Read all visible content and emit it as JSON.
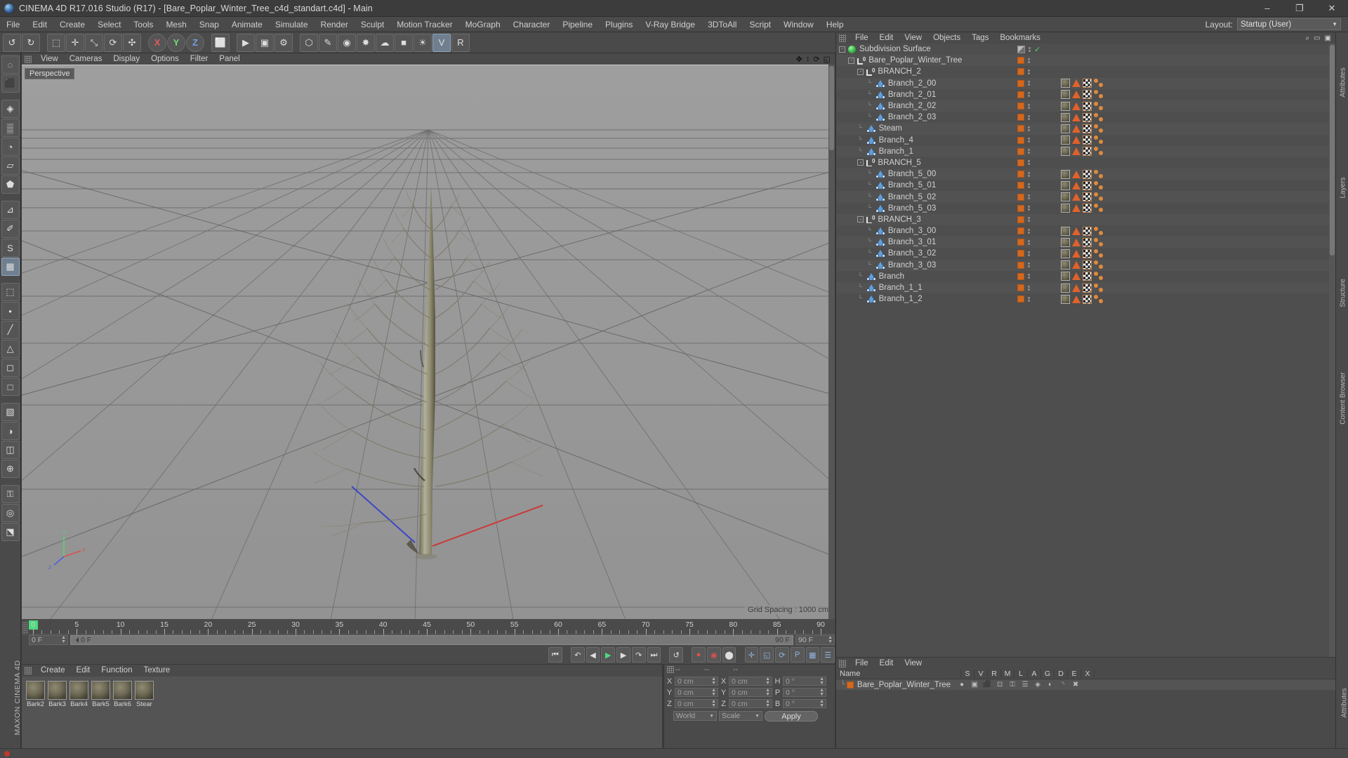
{
  "window": {
    "title": "CINEMA 4D R17.016 Studio (R17) - [Bare_Poplar_Winter_Tree_c4d_standart.c4d] - Main",
    "minimize": "–",
    "maximize": "❐",
    "close": "✕",
    "app_icon": "cinema4d-logo-icon"
  },
  "menubar": {
    "items": [
      "File",
      "Edit",
      "Create",
      "Select",
      "Tools",
      "Mesh",
      "Snap",
      "Animate",
      "Simulate",
      "Render",
      "Sculpt",
      "Motion Tracker",
      "MoGraph",
      "Character",
      "Pipeline",
      "Plugins",
      "V-Ray Bridge",
      "3DToAll",
      "Script",
      "Window",
      "Help"
    ],
    "layout_label": "Layout:",
    "layout_value": "Startup (User)"
  },
  "toolbar": {
    "buttons": [
      {
        "name": "undo-button",
        "glyph": "↺"
      },
      {
        "name": "redo-button",
        "glyph": "↻"
      },
      {
        "name": "live-selection-tool",
        "glyph": "⬚"
      },
      {
        "name": "move-tool",
        "glyph": "✛"
      },
      {
        "name": "scale-tool",
        "glyph": "⤡"
      },
      {
        "name": "rotate-tool",
        "glyph": "⟳"
      },
      {
        "name": "auto-tool",
        "glyph": "✣"
      },
      {
        "name": "axis-x-lock",
        "glyph": "X"
      },
      {
        "name": "axis-y-lock",
        "glyph": "Y"
      },
      {
        "name": "axis-z-lock",
        "glyph": "Z"
      },
      {
        "name": "world-object-coords",
        "glyph": "⬜"
      },
      {
        "name": "render-view-button",
        "glyph": "▶"
      },
      {
        "name": "render-region-button",
        "glyph": "▣"
      },
      {
        "name": "render-settings-button",
        "glyph": "⚙"
      },
      {
        "name": "cube-primitive-button",
        "glyph": "⬡"
      },
      {
        "name": "spline-pen-button",
        "glyph": "✎"
      },
      {
        "name": "generator-button",
        "glyph": "◉"
      },
      {
        "name": "deformer-button",
        "glyph": "✸"
      },
      {
        "name": "environment-button",
        "glyph": "☁"
      },
      {
        "name": "camera-button",
        "glyph": "■"
      },
      {
        "name": "light-button",
        "glyph": "☀"
      },
      {
        "name": "vray-button",
        "glyph": "V"
      },
      {
        "name": "vray-render-button",
        "glyph": "R"
      }
    ]
  },
  "left_tools": {
    "buttons": [
      {
        "name": "live-selection-icon",
        "glyph": "◌"
      },
      {
        "name": "box-primitive-icon",
        "glyph": "⬛"
      },
      {
        "name": "magnet-icon",
        "glyph": "◈"
      },
      {
        "name": "knife-icon",
        "glyph": "▒"
      },
      {
        "name": "brush-icon",
        "glyph": "◔"
      },
      {
        "name": "polygon-pen-icon",
        "glyph": "▱"
      },
      {
        "name": "extrude-icon",
        "glyph": "⬟"
      },
      {
        "name": "measure-icon",
        "glyph": "⊿"
      },
      {
        "name": "paint-icon",
        "glyph": "✐"
      },
      {
        "name": "sculpt-icon",
        "glyph": "S"
      },
      {
        "name": "uv-icon",
        "glyph": "▦"
      },
      {
        "name": "axis-icon",
        "glyph": "⬚"
      },
      {
        "name": "point-mode-icon",
        "glyph": "•"
      },
      {
        "name": "edge-mode-icon",
        "glyph": "╱"
      },
      {
        "name": "polygon-mode-icon",
        "glyph": "△"
      },
      {
        "name": "model-mode-icon",
        "glyph": "◻"
      },
      {
        "name": "object-mode-icon",
        "glyph": "□"
      },
      {
        "name": "texture-mode-icon",
        "glyph": "▧"
      },
      {
        "name": "animation-mode-icon",
        "glyph": "◑"
      },
      {
        "name": "workplane-icon",
        "glyph": "◫"
      },
      {
        "name": "enable-axis-icon",
        "glyph": "⊕"
      },
      {
        "name": "lock-icon",
        "glyph": "⚿"
      },
      {
        "name": "viewport-solo-icon",
        "glyph": "◎"
      },
      {
        "name": "snap-icon",
        "glyph": "⬔"
      }
    ]
  },
  "brand_text": "MAXON CINEMA 4D",
  "viewport": {
    "menu": [
      "View",
      "Cameras",
      "Display",
      "Options",
      "Filter",
      "Panel"
    ],
    "label": "Perspective",
    "grid_spacing": "Grid Spacing : 1000 cm",
    "corner_icons": [
      {
        "name": "pan-viewport-icon",
        "glyph": "✥"
      },
      {
        "name": "zoom-viewport-icon",
        "glyph": "↕"
      },
      {
        "name": "rotate-viewport-icon",
        "glyph": "⟳"
      },
      {
        "name": "maximize-viewport-icon",
        "glyph": "◱"
      }
    ]
  },
  "timeline": {
    "ticks": [
      0,
      5,
      10,
      15,
      20,
      25,
      30,
      35,
      40,
      45,
      50,
      55,
      60,
      65,
      70,
      75,
      80,
      85,
      90
    ],
    "current_frame": "0 F",
    "current_frame_field": "0 F",
    "end_frame_field": "90 F",
    "max_frame_field": "90 F",
    "preview_end": "90 F"
  },
  "playback": {
    "buttons": [
      {
        "name": "go-to-start-button",
        "glyph": "⏮"
      },
      {
        "name": "previous-keyframe-button",
        "glyph": "↶"
      },
      {
        "name": "step-back-button",
        "glyph": "◀"
      },
      {
        "name": "play-button",
        "glyph": "▶"
      },
      {
        "name": "step-forward-button",
        "glyph": "▶"
      },
      {
        "name": "next-keyframe-button",
        "glyph": "↷"
      },
      {
        "name": "go-to-end-button",
        "glyph": "⏭"
      },
      {
        "name": "loop-button",
        "glyph": "↺"
      },
      {
        "name": "record-active-objects-button",
        "glyph": "●"
      },
      {
        "name": "autokeying-button",
        "glyph": "◉"
      },
      {
        "name": "keyframe-selection-button",
        "glyph": "⬤"
      },
      {
        "name": "position-key-button",
        "glyph": "✛"
      },
      {
        "name": "scale-key-button",
        "glyph": "◱"
      },
      {
        "name": "rotation-key-button",
        "glyph": "⟳"
      },
      {
        "name": "parameter-key-button",
        "glyph": "P"
      },
      {
        "name": "pla-key-button",
        "glyph": "▦"
      },
      {
        "name": "timeline-settings-button",
        "glyph": "☰"
      }
    ]
  },
  "material_manager": {
    "menu": [
      "Create",
      "Edit",
      "Function",
      "Texture"
    ],
    "materials": [
      {
        "name": "Bark2"
      },
      {
        "name": "Bark3"
      },
      {
        "name": "Bark4"
      },
      {
        "name": "Bark5"
      },
      {
        "name": "Bark6"
      },
      {
        "name": "Stear"
      }
    ]
  },
  "coordinates": {
    "header": [
      "--",
      "--",
      "--"
    ],
    "rows": [
      {
        "pos_label": "X",
        "pos_value": "0 cm",
        "size_label": "X",
        "size_value": "0 cm",
        "rot_label": "H",
        "rot_value": "0 °"
      },
      {
        "pos_label": "Y",
        "pos_value": "0 cm",
        "size_label": "Y",
        "size_value": "0 cm",
        "rot_label": "P",
        "rot_value": "0 °"
      },
      {
        "pos_label": "Z",
        "pos_value": "0 cm",
        "size_label": "Z",
        "size_value": "0 cm",
        "rot_label": "B",
        "rot_value": "0 °"
      }
    ],
    "world_select": "World",
    "scale_select": "Scale",
    "apply_button": "Apply"
  },
  "object_manager": {
    "menu": [
      "File",
      "Edit",
      "View",
      "Objects",
      "Tags",
      "Bookmarks"
    ],
    "rows": [
      {
        "label": "Subdivision Surface",
        "depth": 0,
        "icon": "subdivision-surface-icon",
        "expander": "-",
        "tags": [],
        "swatch": "grey",
        "check": true
      },
      {
        "label": "Bare_Poplar_Winter_Tree",
        "depth": 1,
        "icon": "null-object-icon",
        "expander": "-",
        "tags": [],
        "swatch": "orange"
      },
      {
        "label": "BRANCH_2",
        "depth": 2,
        "icon": "null-object-icon",
        "expander": "-",
        "tags": [],
        "swatch": "orange"
      },
      {
        "label": "Branch_2_00",
        "depth": 3,
        "icon": "polygon-object-icon",
        "expander": "",
        "tags": [
          "material",
          "phong",
          "uv",
          "dots"
        ],
        "swatch": "orange"
      },
      {
        "label": "Branch_2_01",
        "depth": 3,
        "icon": "polygon-object-icon",
        "expander": "",
        "tags": [
          "material",
          "phong",
          "uv",
          "dots"
        ],
        "swatch": "orange"
      },
      {
        "label": "Branch_2_02",
        "depth": 3,
        "icon": "polygon-object-icon",
        "expander": "",
        "tags": [
          "material",
          "phong",
          "uv",
          "dots"
        ],
        "swatch": "orange"
      },
      {
        "label": "Branch_2_03",
        "depth": 3,
        "icon": "polygon-object-icon",
        "expander": "",
        "tags": [
          "material",
          "phong",
          "uv",
          "dots"
        ],
        "swatch": "orange"
      },
      {
        "label": "Steam",
        "depth": 2,
        "icon": "polygon-object-icon",
        "expander": "",
        "tags": [
          "material",
          "phong",
          "uv",
          "dots"
        ],
        "swatch": "orange"
      },
      {
        "label": "Branch_4",
        "depth": 2,
        "icon": "polygon-object-icon",
        "expander": "",
        "tags": [
          "material",
          "phong",
          "uv",
          "dots"
        ],
        "swatch": "orange"
      },
      {
        "label": "Branch_1",
        "depth": 2,
        "icon": "polygon-object-icon",
        "expander": "",
        "tags": [
          "material",
          "phong",
          "uv",
          "dots"
        ],
        "swatch": "orange"
      },
      {
        "label": "BRANCH_5",
        "depth": 2,
        "icon": "null-object-icon",
        "expander": "-",
        "tags": [],
        "swatch": "orange"
      },
      {
        "label": "Branch_5_00",
        "depth": 3,
        "icon": "polygon-object-icon",
        "expander": "",
        "tags": [
          "material",
          "phong",
          "uv",
          "dots"
        ],
        "swatch": "orange"
      },
      {
        "label": "Branch_5_01",
        "depth": 3,
        "icon": "polygon-object-icon",
        "expander": "",
        "tags": [
          "material",
          "phong",
          "uv",
          "dots"
        ],
        "swatch": "orange"
      },
      {
        "label": "Branch_5_02",
        "depth": 3,
        "icon": "polygon-object-icon",
        "expander": "",
        "tags": [
          "material",
          "phong",
          "uv",
          "dots"
        ],
        "swatch": "orange"
      },
      {
        "label": "Branch_5_03",
        "depth": 3,
        "icon": "polygon-object-icon",
        "expander": "",
        "tags": [
          "material",
          "phong",
          "uv",
          "dots"
        ],
        "swatch": "orange"
      },
      {
        "label": "BRANCH_3",
        "depth": 2,
        "icon": "null-object-icon",
        "expander": "-",
        "tags": [],
        "swatch": "orange"
      },
      {
        "label": "Branch_3_00",
        "depth": 3,
        "icon": "polygon-object-icon",
        "expander": "",
        "tags": [
          "material",
          "phong",
          "uv",
          "dots"
        ],
        "swatch": "orange"
      },
      {
        "label": "Branch_3_01",
        "depth": 3,
        "icon": "polygon-object-icon",
        "expander": "",
        "tags": [
          "material",
          "phong",
          "uv",
          "dots"
        ],
        "swatch": "orange"
      },
      {
        "label": "Branch_3_02",
        "depth": 3,
        "icon": "polygon-object-icon",
        "expander": "",
        "tags": [
          "material",
          "phong",
          "uv",
          "dots"
        ],
        "swatch": "orange"
      },
      {
        "label": "Branch_3_03",
        "depth": 3,
        "icon": "polygon-object-icon",
        "expander": "",
        "tags": [
          "material",
          "phong",
          "uv",
          "dots"
        ],
        "swatch": "orange"
      },
      {
        "label": "Branch",
        "depth": 2,
        "icon": "polygon-object-icon",
        "expander": "",
        "tags": [
          "material",
          "phong",
          "uv",
          "dots"
        ],
        "swatch": "orange"
      },
      {
        "label": "Branch_1_1",
        "depth": 2,
        "icon": "polygon-object-icon",
        "expander": "",
        "tags": [
          "material",
          "phong",
          "uv",
          "dots"
        ],
        "swatch": "orange"
      },
      {
        "label": "Branch_1_2",
        "depth": 2,
        "icon": "polygon-object-icon",
        "expander": "",
        "tags": [
          "material",
          "phong",
          "uv",
          "dots"
        ],
        "swatch": "orange"
      }
    ]
  },
  "structure_manager": {
    "menu": [
      "File",
      "Edit",
      "View"
    ],
    "columns": [
      "Name",
      "S",
      "V",
      "R",
      "M",
      "L",
      "A",
      "G",
      "D",
      "E",
      "X"
    ],
    "row": {
      "name": "Bare_Poplar_Winter_Tree",
      "icons": [
        "●",
        "▣",
        "⬛",
        "⊡",
        "⚿",
        "☰",
        "◈",
        "◐",
        "◝",
        "✖"
      ]
    }
  },
  "right_tabs": [
    "Attributes",
    "Layers",
    "Structure",
    "Content Browser"
  ],
  "right_tabs_bottom": [
    "Attributes"
  ],
  "statusbar": {
    "text": ""
  }
}
